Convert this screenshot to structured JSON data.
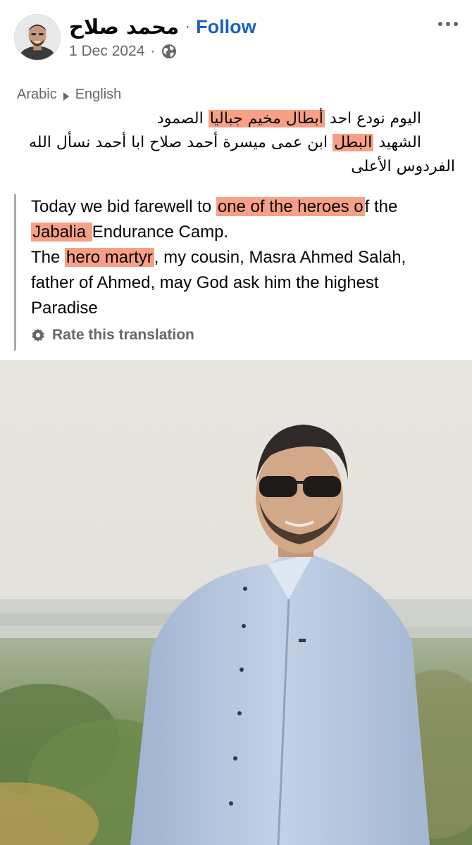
{
  "header": {
    "author_name": "محمد صلاح",
    "separator": "·",
    "follow_label": "Follow",
    "date": "1 Dec 2024",
    "date_separator": "·",
    "privacy_icon": "globe-icon",
    "more_icon": "more-horizontal-icon"
  },
  "translation_bar": {
    "source_lang": "Arabic",
    "target_lang": "English"
  },
  "original_text": {
    "line1_pre": "اليوم نودع احد ",
    "line1_hl": "أبطال مخيم جباليا",
    "line1_post": " الصمود",
    "line2_pre": "الشهيد ",
    "line2_hl": "البطل",
    "line2_post": " ابن عمى ميسرة أحمد صلاح   ابا أحمد نسأل الله",
    "line3": "الفردوس الأعلى"
  },
  "translated_text": {
    "s1_pre": "Today we bid farewell to ",
    "s1_hl": "one of the heroes o",
    "s1_post": "f the",
    "s2_hl": "Jabalia ",
    "s2_post": "Endurance Camp.",
    "s3_pre": "The ",
    "s3_hl": "hero martyr",
    "s3_post": ", my cousin, Masra Ahmed Salah,",
    "s4": "father of Ahmed, may God ask him the highest",
    "s5": "Paradise"
  },
  "rate_label": "Rate this translation",
  "colors": {
    "follow": "#1b5fc1",
    "highlight": "#f7a085",
    "muted": "#65676b"
  }
}
